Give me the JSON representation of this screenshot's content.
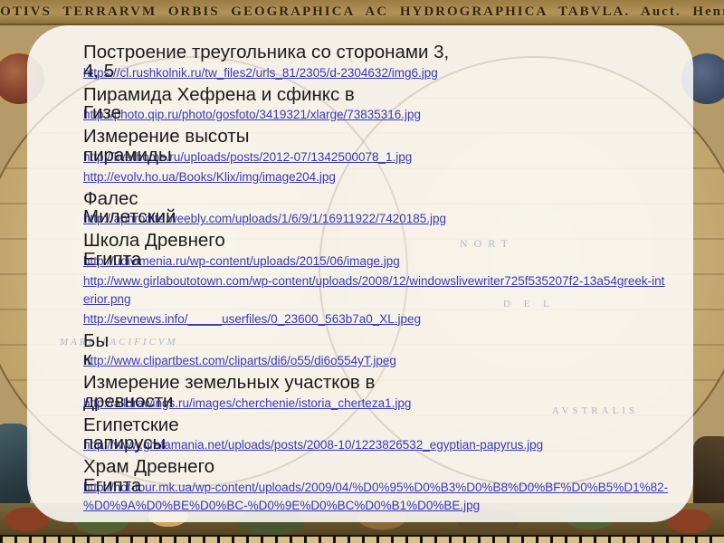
{
  "map": {
    "banner": "VA TOTIVS TERRARVM ORBIS GEOGRAPHICA AC HYDROGRAPHICA TABVLA. Auct. Henr. Ho",
    "ghost_labels": [
      "NORT",
      "MARE PACIFICVM",
      "D E L",
      "AVSTRALIS"
    ],
    "colors": {
      "parchment": "#c3aa72",
      "banner_background": "#a78b52",
      "frieze_background": "#5f4f2e"
    }
  },
  "slide": {
    "panel_background": "rgba(253,252,248,0.88)",
    "title_color": "#1c1c1c",
    "link_color": "#3838bb",
    "items": [
      {
        "title_lines": [
          "Построение треугольника со сторонами 3,",
          "4, 5"
        ],
        "url": "https://cl.rushkolnik.ru/tw_files2/urls_81/2305/d-2304632/img6.jpg"
      },
      {
        "title_lines": [
          "Пирамида Хефрена и сфинкс в",
          "Гизе"
        ],
        "url": "http://photo.qip.ru/photo/gosfoto/3419321/xlarge/73835316.jpg"
      },
      {
        "title_lines": [
          "Измерение высоты",
          "пирамиды"
        ],
        "url": "http://livethome.ru/uploads/posts/2012-07/1342500078_1.jpg"
      },
      {
        "title_lines": [],
        "url": "http://evolv.ho.ua/Books/Klix/img/image204.jpg"
      },
      {
        "title_lines": [
          "Фалес",
          "Милетский"
        ],
        "url": "http://aphrodite.weebly.com/uploads/1/6/9/1/16911922/7420185.jpg"
      },
      {
        "title_lines": [
          "Школа Древнего",
          "Египта"
        ],
        "url": "http://udivimenia.ru/wp-content/uploads/2015/06/image.jpg"
      },
      {
        "title_lines": [],
        "url": "http://www.girlaboutotown.com/wp-content/uploads/2008/12/windowslivewriter725f535207f2-13a54greek-interior.png"
      },
      {
        "title_lines": [],
        "url": "http://sevnews.info/_____userfiles/0_23600_563b7a0_XL.jpeg"
      },
      {
        "title_lines": [
          "Бы",
          "к"
        ],
        "url": "http://www.clipartbest.com/cliparts/di6/o55/di6o554yT.jpeg"
      },
      {
        "title_lines": [
          "Измерение земельных участков в",
          "древности"
        ],
        "url": "http://alldrawings.ru/images/cherchenie/istoria_cherteza1.jpg"
      },
      {
        "title_lines": [
          "Египетские",
          "папирусы"
        ],
        "url": "http://www.grafamania.net/uploads/posts/2008-10/1223826532_egyptian-papyrus.jpg"
      },
      {
        "title_lines": [
          "Храм Древнего",
          "Египта"
        ],
        "url": "http://hot-tour.mk.ua/wp-content/uploads/2009/04/%D0%95%D0%B3%D0%B8%D0%BF%D0%B5%D1%82-%D0%9A%D0%BE%D0%BC-%D0%9E%D0%BC%D0%B1%D0%BE.jpg"
      }
    ]
  }
}
